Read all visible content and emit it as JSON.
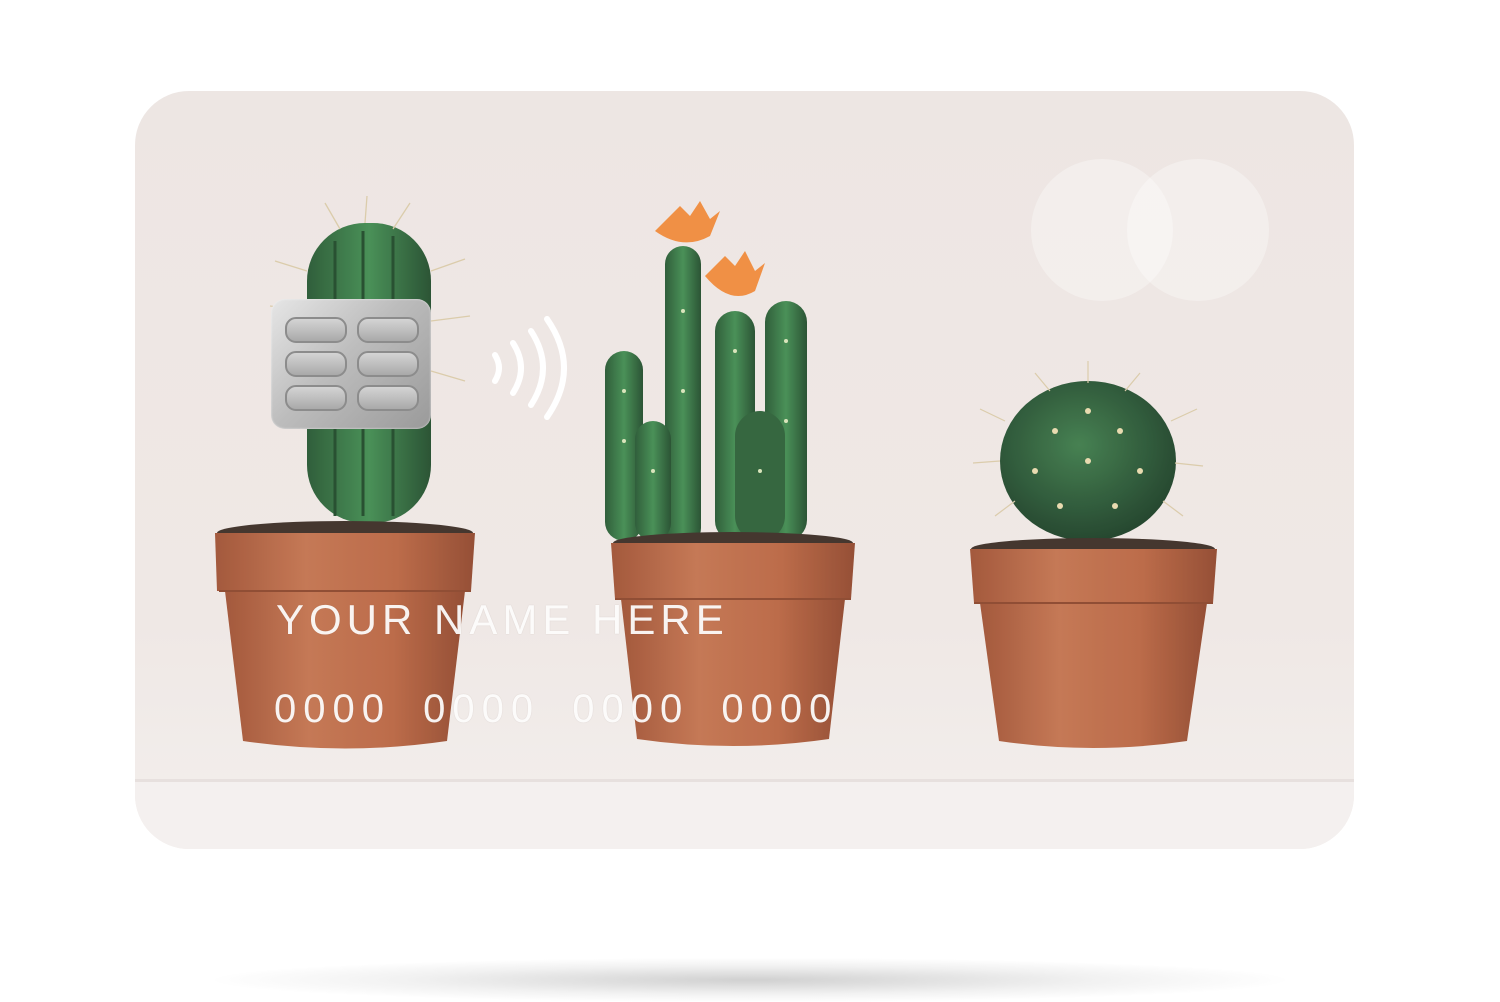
{
  "card": {
    "holder_name": "YOUR NAME HERE",
    "number_groups": [
      "0000",
      "0000",
      "0000",
      "0000"
    ],
    "chip": "emv-chip",
    "contactless": "contactless-icon",
    "brand": "mastercard-logo",
    "background_image": "three potted cacti"
  },
  "colors": {
    "background": "#ece5e2",
    "pot": "#b5623f",
    "cactus": "#2f6a3c",
    "flower": "#f08a3a",
    "text": "#ffffff"
  }
}
